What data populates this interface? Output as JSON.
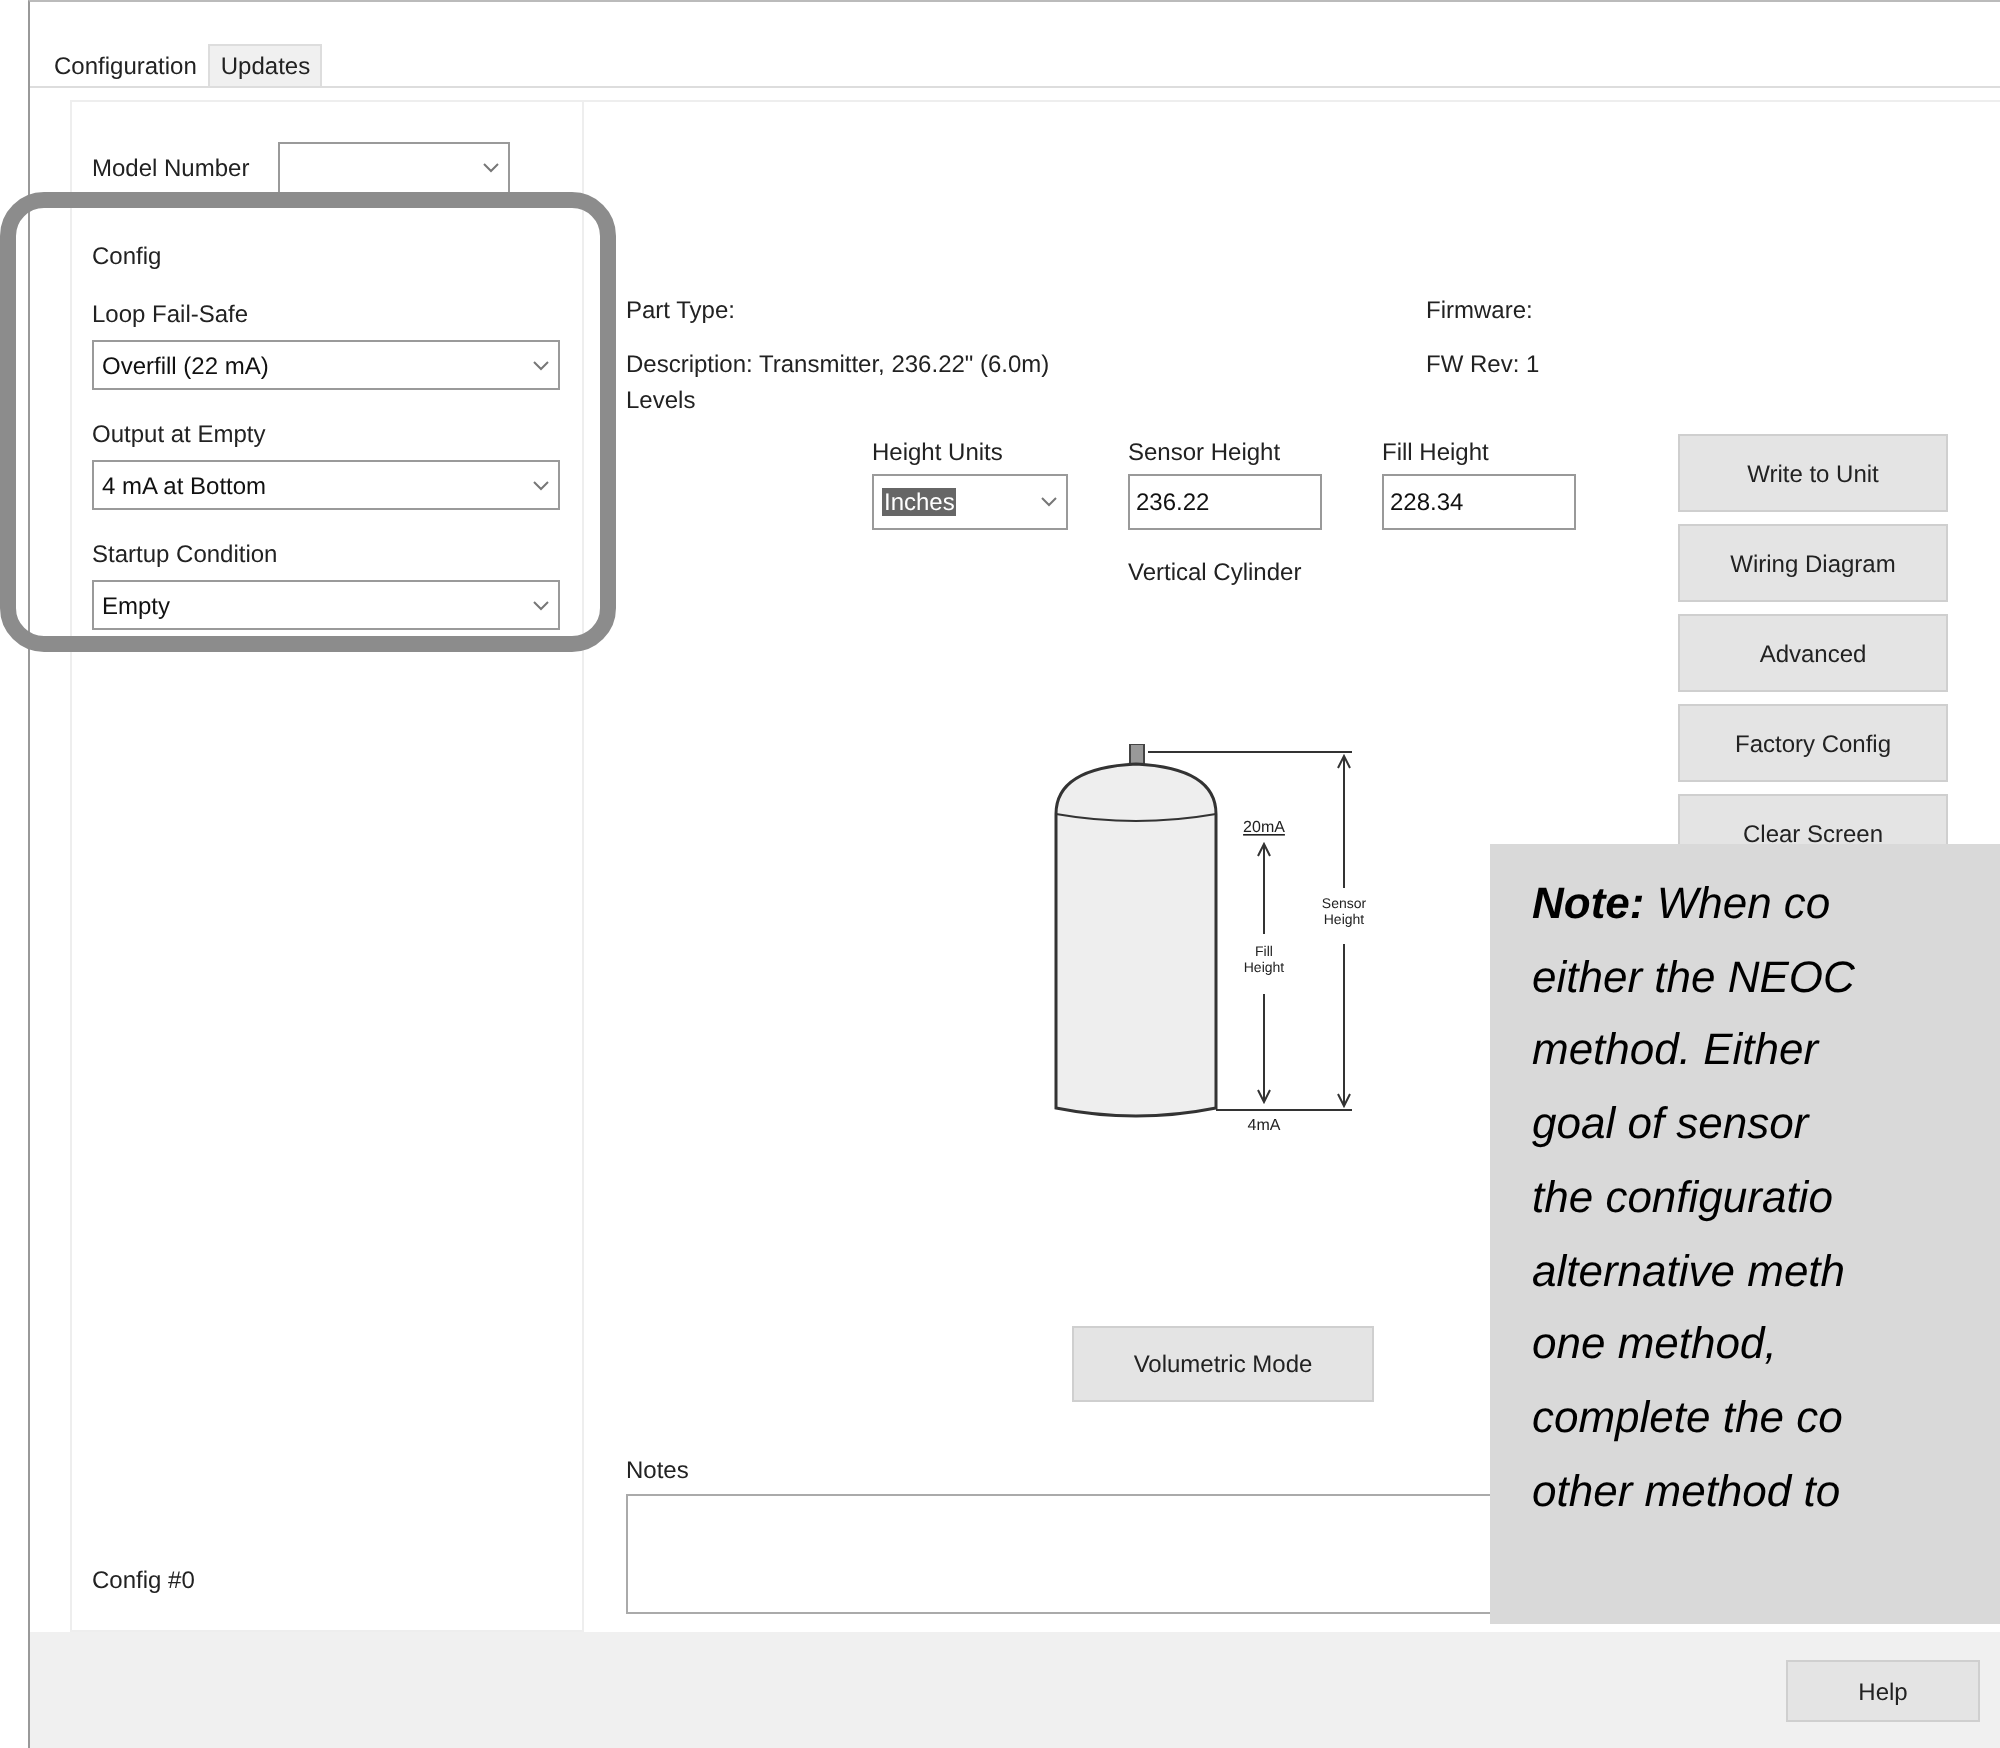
{
  "tabs": [
    {
      "label": "Configuration",
      "selected": true
    },
    {
      "label": "Updates",
      "selected": false
    }
  ],
  "model_number": {
    "label": "Model Number"
  },
  "config": {
    "title": "Config",
    "fields": [
      {
        "label": "Loop Fail-Safe",
        "value": "Overfill (22 mA)"
      },
      {
        "label": "Output at Empty",
        "value": "4 mA at Bottom"
      },
      {
        "label": "Startup Condition",
        "value": "Empty"
      }
    ]
  },
  "config_number": "Config #0",
  "info": {
    "part_type": "Part Type:",
    "firmware": "Firmware:",
    "description": "Description: Transmitter, 236.22\" (6.0m)",
    "fw_rev": "FW Rev: 1"
  },
  "levels": {
    "title": "Levels",
    "height_units": {
      "label": "Height Units",
      "value": "Inches"
    },
    "sensor_height": {
      "label": "Sensor Height",
      "value": "236.22"
    },
    "fill_height": {
      "label": "Fill Height",
      "value": "228.34"
    },
    "shape": "Vertical Cylinder"
  },
  "diagram": {
    "top": "20mA",
    "fill": "Fill Height",
    "sensor": "Sensor Height",
    "bottom": "4mA"
  },
  "action_buttons": [
    "Write to Unit",
    "Wiring Diagram",
    "Advanced",
    "Factory Config",
    "Clear Screen"
  ],
  "volumetric_button": "Volumetric Mode",
  "notes": {
    "label": "Notes"
  },
  "help_button": "Help",
  "note_overlay": [
    "**Note:** When co",
    "either the NEOC",
    "method. Either",
    "goal of sensor",
    "the configuratio",
    "alternative meth",
    "one method,",
    "complete the co",
    "other method to"
  ]
}
